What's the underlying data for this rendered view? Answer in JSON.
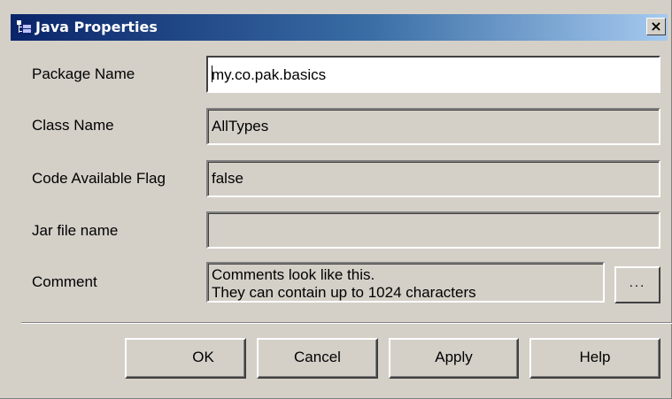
{
  "window": {
    "title": "Java Properties",
    "close_glyph": "×",
    "icon": "class-tree-icon"
  },
  "fields": {
    "package_name": {
      "label": "Package Name",
      "value": "my.co.pak.basics"
    },
    "class_name": {
      "label": "Class Name",
      "value": "AllTypes"
    },
    "code_available_flag": {
      "label": "Code Available Flag",
      "value": "false"
    },
    "jar_file_name": {
      "label": "Jar file name",
      "value": ""
    },
    "comment": {
      "label": "Comment",
      "line1": "Comments look like this.",
      "line2": "They can contain up to 1024 characters",
      "browse_label": "..."
    }
  },
  "buttons": {
    "ok": "OK",
    "cancel": "Cancel",
    "apply": "Apply",
    "help": "Help"
  },
  "colors": {
    "dialog_bg": "#d4d0c8",
    "titlebar_start": "#0a246a",
    "titlebar_end": "#a6caf0"
  }
}
